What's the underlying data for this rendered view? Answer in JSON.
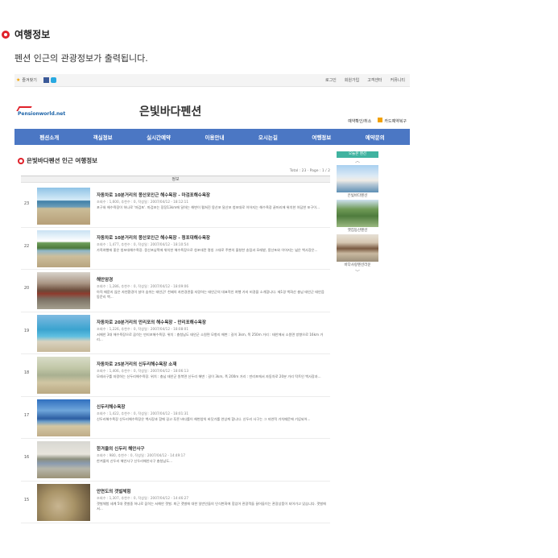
{
  "section": {
    "title": "여행정보",
    "description": "펜션 인근의 관광정보가 출력됩니다."
  },
  "topbar": {
    "favorite": "즐겨찾기",
    "links": [
      "로그인",
      "회원가입",
      "고객센터",
      "커뮤니티"
    ]
  },
  "brand": {
    "logo": "Pensionworld.net",
    "name": "은빛바다펜션",
    "reservation": "예약확인/취소",
    "card": "카드예약복구"
  },
  "nav": [
    "펜션소개",
    "객실정보",
    "실시간예약",
    "이용안내",
    "오시는길",
    "여행정보",
    "예약문의"
  ],
  "content": {
    "title": "은빛바다펜션 인근 여행정보",
    "total": "Total : 23 · Page : 1 / 2",
    "column": "정보",
    "rows": [
      {
        "num": "23",
        "title": "자동차로 10분거리의 몽산포인근 해수욕장 - 마검포해수욕장",
        "meta": "조회수 : 1,600, 추천수 : 0, 작성일 : 2007/04/12 - 18:12:11",
        "snippet": "포구와 해수욕장이 하나로 '마검포'. 마검포는 장장13km에 달하는 해변이 펼쳐진 몽산포 달산포 청포대로 이어지는 해수욕장 끝머리에 위치한 아담한 포구이...",
        "img": "beach"
      },
      {
        "num": "22",
        "title": "자동차로 10분거리의 몽산포인근 해수욕장 - 청포대해수욕장",
        "meta": "조회수 : 1,477, 추천수 : 0, 작성일 : 2007/04/12 - 18:10:54",
        "snippet": "가족여행에 좋은 청포대해수욕장. 몽산포남쪽에 위치한 해수욕장으로 청포대란 명칭 그대로 주변의 울창한 송림과 모래밭, 몽산포와 이어지는 넓은 백사장은...",
        "img": "beach2"
      },
      {
        "num": "20",
        "title": "해안암경",
        "meta": "조회수 : 1,286, 추천수 : 0, 작성일 : 2007/04/12 - 18:09:06",
        "snippet": "아직 때묻지 않은 자연환경이 살아 숨쉬는 태안군! 천혜의 자연경관을 자랑하는 태안군의 대표적인 여행 가지 비경을 소개합니다. 제1경 백화산 충남 태안군 태안읍 동문리 백...",
        "img": "temple"
      },
      {
        "num": "19",
        "title": "자동차로 20분거리의 만리포의 해수욕장 - 만리포해수욕장",
        "meta": "조회수 : 1,226, 추천수 : 0, 작성일 : 2007/04/12 - 18:08:01",
        "snippet": "서해안 3대 해수욕장으로 꼽히는 만리포해수욕장. 위치 : 충청남도 태안군 소원면 모항리 해변 : 길이 3km, 폭 250m 거리 : 태안에서 소원면 방향으로 16km 거리...",
        "img": "crowd"
      },
      {
        "num": "18",
        "title": "자동차로 25분거리의 신두리해수욕장 소재",
        "meta": "조회수 : 1,406, 추천수 : 0, 작성일 : 2007/04/12 - 18:06:13",
        "snippet": "모래사구를 자랑하는 신두리해수욕장. 위치 : 충남 태안군 원북면 신두리 해변 : 길이 3km, 폭 200m 거리 : 만리포에서 자동차로 20분 거리 탁트인 백사장과...",
        "img": "sandy"
      },
      {
        "num": "17",
        "title": "신두리해수욕장",
        "meta": "조회수 : 1,422, 추천수 : 0, 작성일 : 2007/04/12 - 18:01:31",
        "snippet": "신두리해수욕장 신두리해수욕장은 백사장과 함께 길고 푸른 바다를이 해변양의 바닷가를 연상케 합니다. 신두리 사구는 그 자연적 가치때문에 기념되어...",
        "img": "blue"
      },
      {
        "num": "16",
        "title": "한겨울의 신두리 해안사구",
        "meta": "조회수 : 980, 추천수 : 0, 작성일 : 2007/04/12 - 14:49:17",
        "snippet": "한겨울의 신두리 해안사구                          신두리해안사구 충청남도...",
        "img": "sunset"
      },
      {
        "num": "15",
        "title": "안면도의 갯벌체험",
        "meta": "조회수 : 1,307, 추천수 : 0, 작성일 : 2007/04/12 - 14:46:27",
        "snippet": "갯벌체험 세계 5대 갯벌중 하나로 꼽히는 서해안 갯벌. 최근 갯벌에 대한 일반인들의 인식변화에 힘입어 관광객들 끌어들이는 관광상품이 되어가고 있습니다. 갯벌에서...",
        "img": "sand"
      }
    ]
  },
  "sidebar": {
    "label": "오늘본 펜션",
    "items": [
      {
        "caption": "은빛바다펜션",
        "img": "villa"
      },
      {
        "caption": "옛집동산펜션",
        "img": "green"
      },
      {
        "caption": "바다사랑펜션라운",
        "img": "house"
      }
    ]
  },
  "colors": {
    "nav": "#4b77c4",
    "accent": "#e0212a",
    "sidebar_label": "#40b3a0"
  }
}
